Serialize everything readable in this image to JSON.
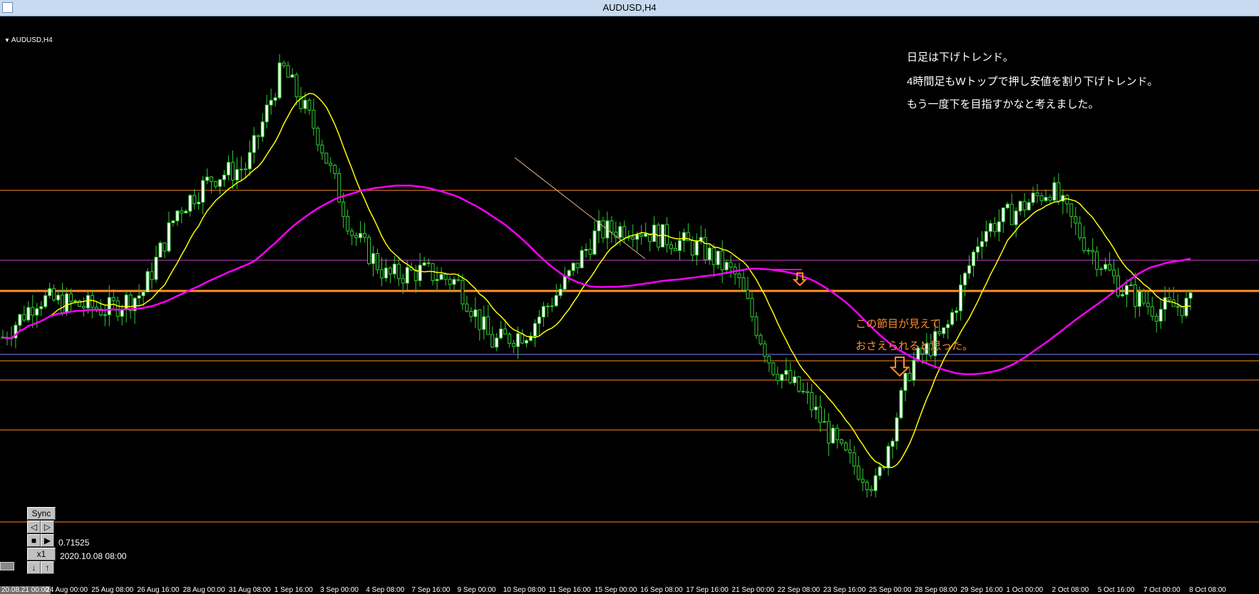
{
  "window": {
    "title": "AUDUSD,H4"
  },
  "chart": {
    "symbol_label": "AUDUSD,H4",
    "notes": [
      "日足は下げトレンド。",
      "4時間足もWトップで押し安値を割り下げトレンド。",
      "もう一度下を目指すかなと考えました。"
    ],
    "annotation": [
      "この節目が見えて",
      "おさえられると思った。"
    ],
    "x_labels": [
      "20.08.21 00:00",
      "24 Aug 00:00",
      "25 Aug 08:00",
      "26 Aug 16:00",
      "28 Aug 00:00",
      "31 Aug 08:00",
      "1 Sep 16:00",
      "3 Sep 00:00",
      "4 Sep 08:00",
      "7 Sep 16:00",
      "9 Sep 00:00",
      "10 Sep 08:00",
      "11 Sep 16:00",
      "15 Sep 00:00",
      "16 Sep 08:00",
      "17 Sep 16:00",
      "21 Sep 00:00",
      "22 Sep 08:00",
      "23 Sep 16:00",
      "25 Sep 00:00",
      "28 Sep 08:00",
      "29 Sep 16:00",
      "1 Oct 00:00",
      "2 Oct 08:00",
      "5 Oct 16:00",
      "7 Oct 00:00",
      "8 Oct 08:00"
    ],
    "colors": {
      "background": "#000000",
      "candle_up": "#ffffff",
      "candle_down": "#32cd32",
      "wick": "#32cd32",
      "ma_short": "#ffff00",
      "ma_long": "#ff00ff",
      "level_line": "#ff8c28",
      "level_line_purple": "#cc44cc",
      "annotation": "#ff8c28"
    }
  },
  "chart_data": {
    "type": "candlestick",
    "series": [
      {
        "name": "candles_close_path",
        "values": [
          0.7165,
          0.72,
          0.7195,
          0.719,
          0.7205,
          0.728,
          0.731,
          0.732,
          0.741,
          0.735,
          0.726,
          0.722,
          0.7225,
          0.7215,
          0.716,
          0.717,
          0.721,
          0.726,
          0.7265,
          0.7255,
          0.7245,
          0.722,
          0.714,
          0.711,
          0.706,
          0.703,
          0.714,
          0.717,
          0.726,
          0.728,
          0.73,
          0.725,
          0.721,
          0.719,
          0.7195
        ]
      }
    ],
    "y_readout": "0.71525",
    "date_readout": "2020.10.08 08:00"
  },
  "control": {
    "sync_label": "Sync",
    "multiplier_label": "x1",
    "price_value": "0.71525",
    "date_value": "2020.10.08 08:00"
  }
}
